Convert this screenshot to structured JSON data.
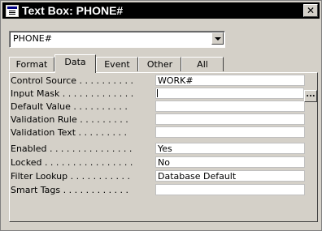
{
  "window": {
    "title": "Text Box: PHONE#",
    "close_glyph": "✕"
  },
  "selector": {
    "value": "PHONE#"
  },
  "tabs": [
    {
      "label": "Format"
    },
    {
      "label": "Data"
    },
    {
      "label": "Event"
    },
    {
      "label": "Other"
    },
    {
      "label": "All"
    }
  ],
  "active_tab": "Data",
  "properties": [
    {
      "label": "Control Source . . . . . . . . . .",
      "value": "WORK#"
    },
    {
      "label": "Input Mask . . . . . . . . . . . . .",
      "value": ""
    },
    {
      "label": "Default Value . . . . . . . . . .",
      "value": ""
    },
    {
      "label": "Validation Rule . . . . . . . . .",
      "value": ""
    },
    {
      "label": "Validation Text . . . . . . . . .",
      "value": ""
    },
    {
      "label": "Enabled . . . . . . . . . . . . . . .",
      "value": "Yes"
    },
    {
      "label": "Locked . . . . . . . . . . . . . . . .",
      "value": "No"
    },
    {
      "label": "Filter Lookup . . . . . . . . . . .",
      "value": "Database Default"
    },
    {
      "label": "Smart Tags . . . . . . . . . . . .",
      "value": ""
    }
  ],
  "builder_button": {
    "label": "..."
  }
}
